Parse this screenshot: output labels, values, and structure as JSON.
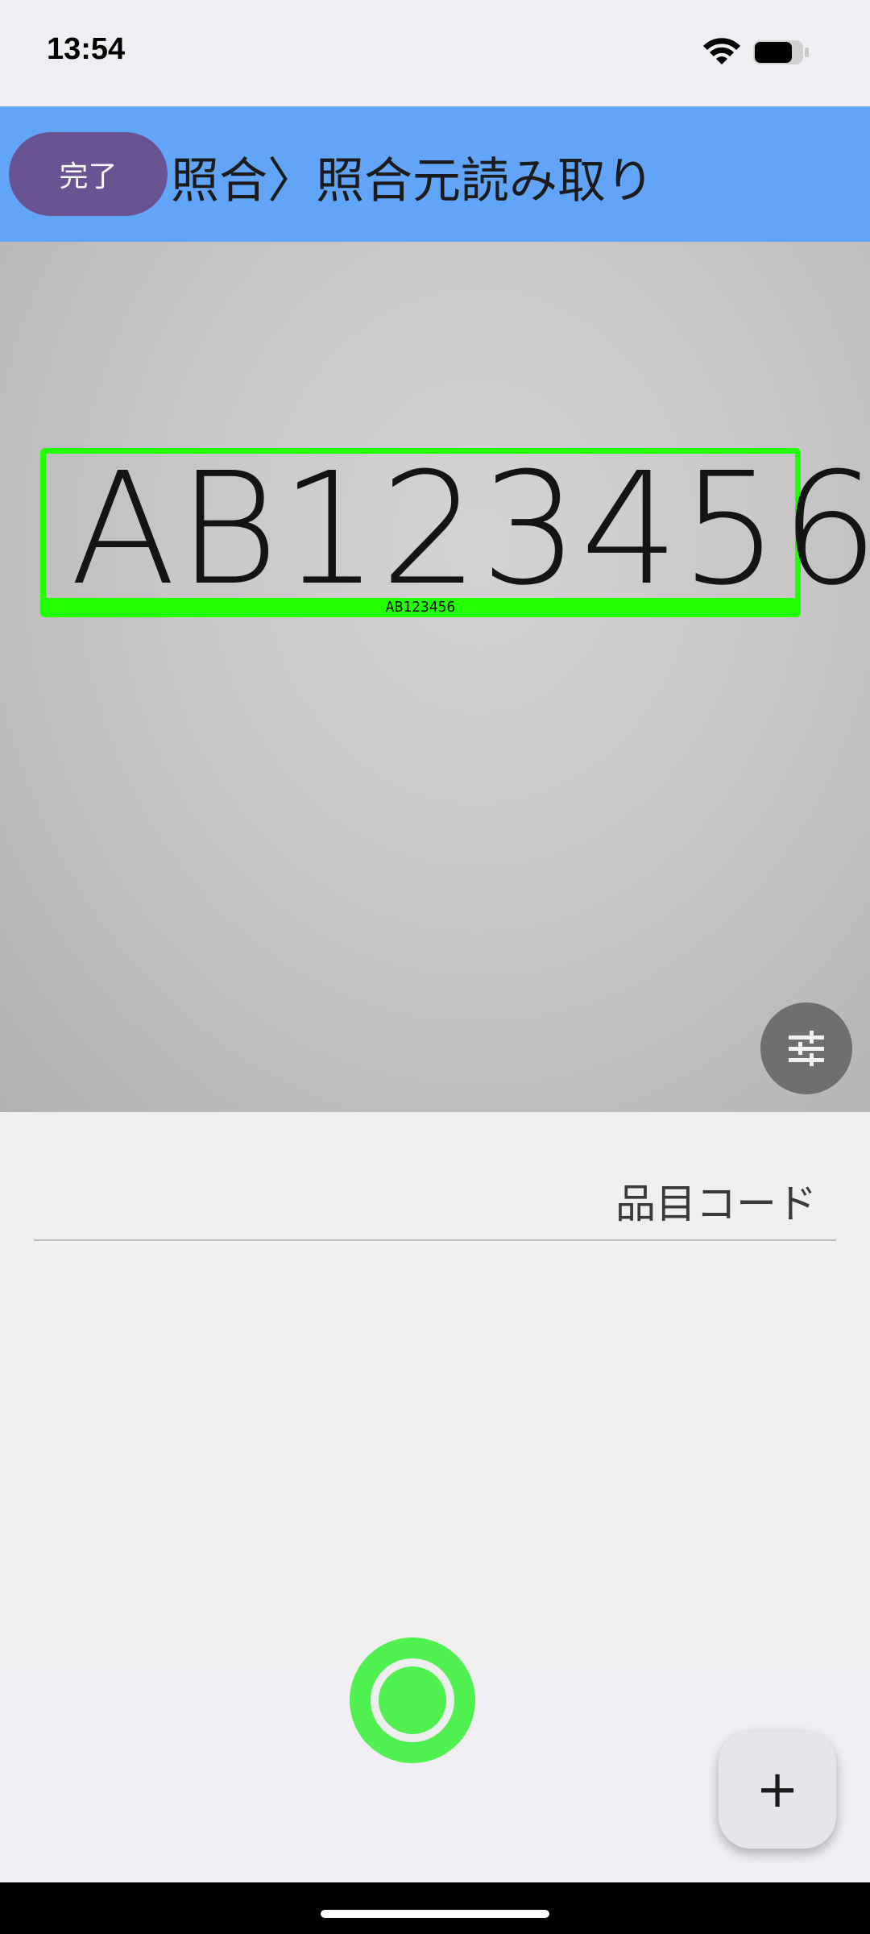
{
  "status_bar": {
    "time": "13:54"
  },
  "header": {
    "title": "照合〉照合元読み取り",
    "done_label": "完了",
    "background_color": "#62a5f8",
    "done_color": "#6a5393"
  },
  "camera": {
    "scanned_text": "AB123456",
    "detection_label": "AB123456",
    "detection_color": "#22ff00"
  },
  "form": {
    "item_code_label": "品目コード"
  },
  "controls": {
    "shutter_color": "#50f050",
    "settings_icon": "tune-icon",
    "add_label": "+"
  }
}
